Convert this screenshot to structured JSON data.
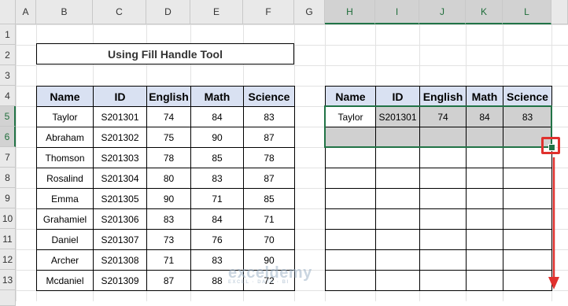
{
  "column_headers": [
    "A",
    "B",
    "C",
    "D",
    "E",
    "F",
    "G",
    "H",
    "I",
    "J",
    "K",
    "L"
  ],
  "row_headers": [
    "1",
    "2",
    "3",
    "4",
    "5",
    "6",
    "7",
    "8",
    "9",
    "10",
    "11",
    "12",
    "13"
  ],
  "title": "Using Fill Handle Tool",
  "left_table": {
    "headers": [
      "Name",
      "ID",
      "English",
      "Math",
      "Science"
    ],
    "rows": [
      [
        "Taylor",
        "S201301",
        "74",
        "84",
        "83"
      ],
      [
        "Abraham",
        "S201302",
        "75",
        "90",
        "87"
      ],
      [
        "Thomson",
        "S201303",
        "78",
        "85",
        "78"
      ],
      [
        "Rosalind",
        "S201304",
        "80",
        "83",
        "87"
      ],
      [
        "Emma",
        "S201305",
        "90",
        "71",
        "85"
      ],
      [
        "Grahamiel",
        "S201306",
        "83",
        "84",
        "71"
      ],
      [
        "Daniel",
        "S201307",
        "73",
        "76",
        "70"
      ],
      [
        "Archer",
        "S201308",
        "71",
        "83",
        "90"
      ],
      [
        "Mcdaniel",
        "S201309",
        "87",
        "88",
        "72"
      ]
    ]
  },
  "right_table": {
    "headers": [
      "Name",
      "ID",
      "English",
      "Math",
      "Science"
    ],
    "rows": [
      [
        "Taylor",
        "S201301",
        "74",
        "84",
        "83"
      ]
    ]
  },
  "watermark": {
    "brand": "exceldemy",
    "tagline": "EXCEL · DATA · BI"
  },
  "colors": {
    "header_fill": "#d9e1f2",
    "selection_fill": "#d0d0d0",
    "selection_border": "#217346",
    "annotation": "#e0312e"
  }
}
